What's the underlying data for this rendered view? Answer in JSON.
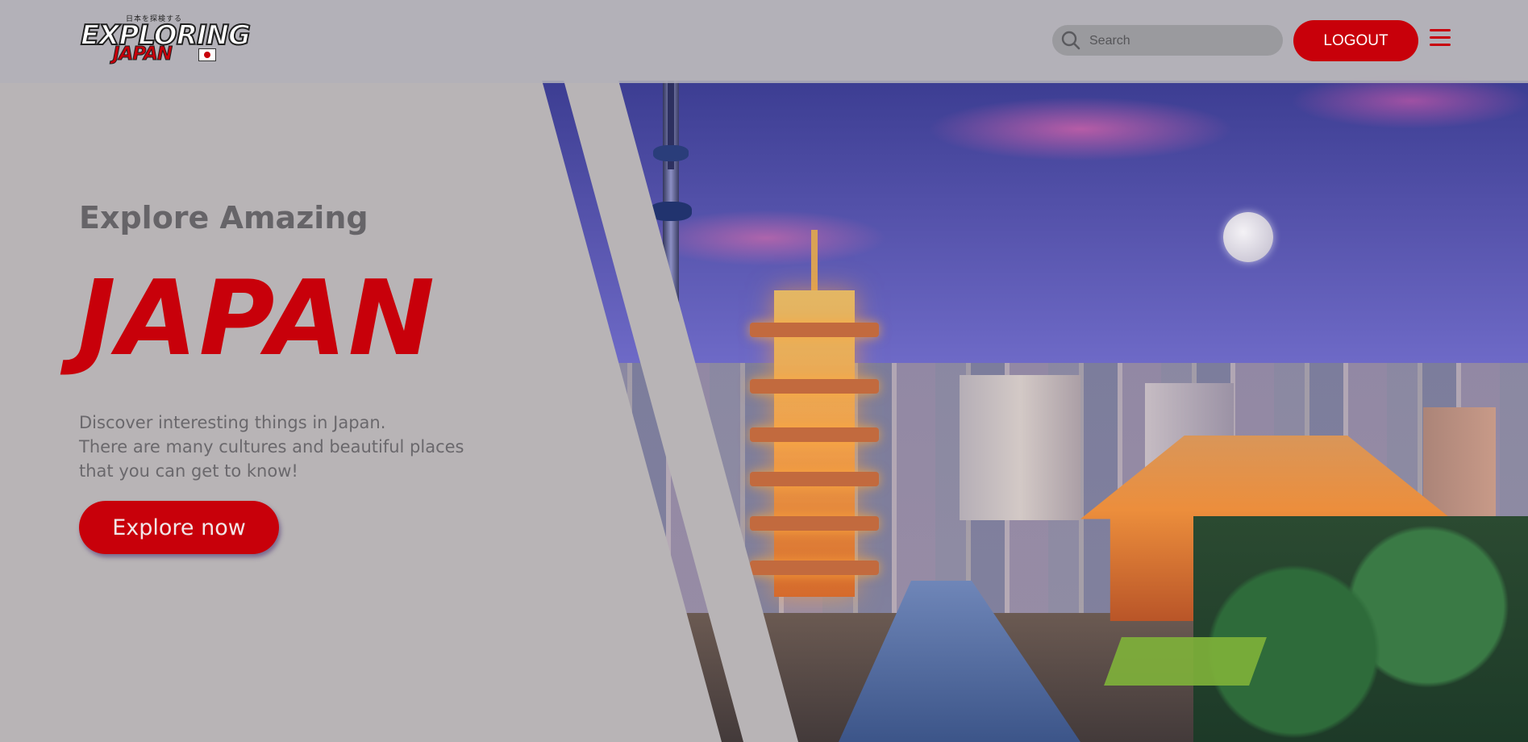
{
  "header": {
    "logo": {
      "kana": "日本を探検する",
      "top_text": "EXPLORING",
      "bottom_text": "JAPAN",
      "flag_icon": "japan-flag-icon"
    },
    "search": {
      "placeholder": "Search",
      "value": "",
      "icon": "search-icon"
    },
    "logout_label": "LOGOUT",
    "menu_icon": "hamburger-menu-icon"
  },
  "hero": {
    "subtitle": "Explore Amazing",
    "title": "JAPAN",
    "description_lines": [
      "Discover interesting things in Japan.",
      "There are many cultures and beautiful places",
      "that you can get to know!"
    ],
    "cta_label": "Explore now",
    "background": "tokyo-skyline-image"
  },
  "colors": {
    "accent": "#c8000a",
    "overlay_gray": "#b8b4b6",
    "text_gray": "#666468"
  }
}
